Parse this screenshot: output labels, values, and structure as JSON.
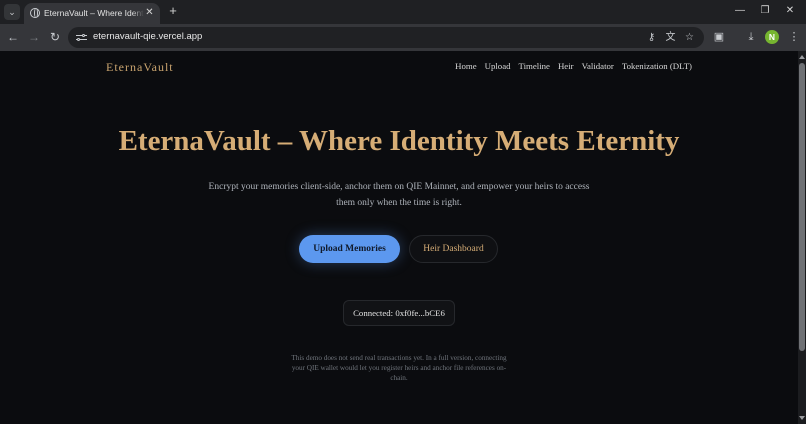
{
  "browser": {
    "tab": {
      "title": "EternaVault – Where Identity Meets Eternity"
    },
    "address_bar": {
      "url": "eternavault-qie.vercel.app"
    },
    "profile_initial": "N",
    "icons": {
      "tab_search": "chevron-down-icon",
      "favicon": "globe-icon",
      "tab_close": "close-icon",
      "new_tab": "plus-icon",
      "back": "back-arrow-icon",
      "forward": "forward-arrow-icon",
      "reload": "reload-icon",
      "site_info": "tune-icon",
      "password": "key-icon",
      "translate": "translate-icon",
      "bookmark": "star-icon",
      "extensions": "puzzle-icon",
      "downloads": "download-icon",
      "menu": "kebab-menu-icon"
    }
  },
  "site": {
    "brand": "EternaVault",
    "nav": {
      "home": "Home",
      "upload": "Upload",
      "timeline": "Timeline",
      "heir": "Heir",
      "validator": "Validator",
      "tokenization": "Tokenization (DLT)"
    },
    "hero": {
      "title": "EternaVault – Where Identity Meets Eternity",
      "subtitle": "Encrypt your memories client-side, anchor them on QIE Mainnet, and empower your heirs to access them only when the time is right."
    },
    "buttons": {
      "upload": "Upload Memories",
      "heir_dashboard": "Heir Dashboard"
    },
    "wallet": {
      "status": "Connected: 0xf0fe...bCE6"
    },
    "note": "This demo does not send real transactions yet. In a full version, connecting your QIE wallet would let you register heirs and anchor file references on-chain.",
    "colors": {
      "accent_gold": "#d6ad76",
      "primary_blue": "#5c98ef",
      "background": "#0b0c0f"
    }
  }
}
